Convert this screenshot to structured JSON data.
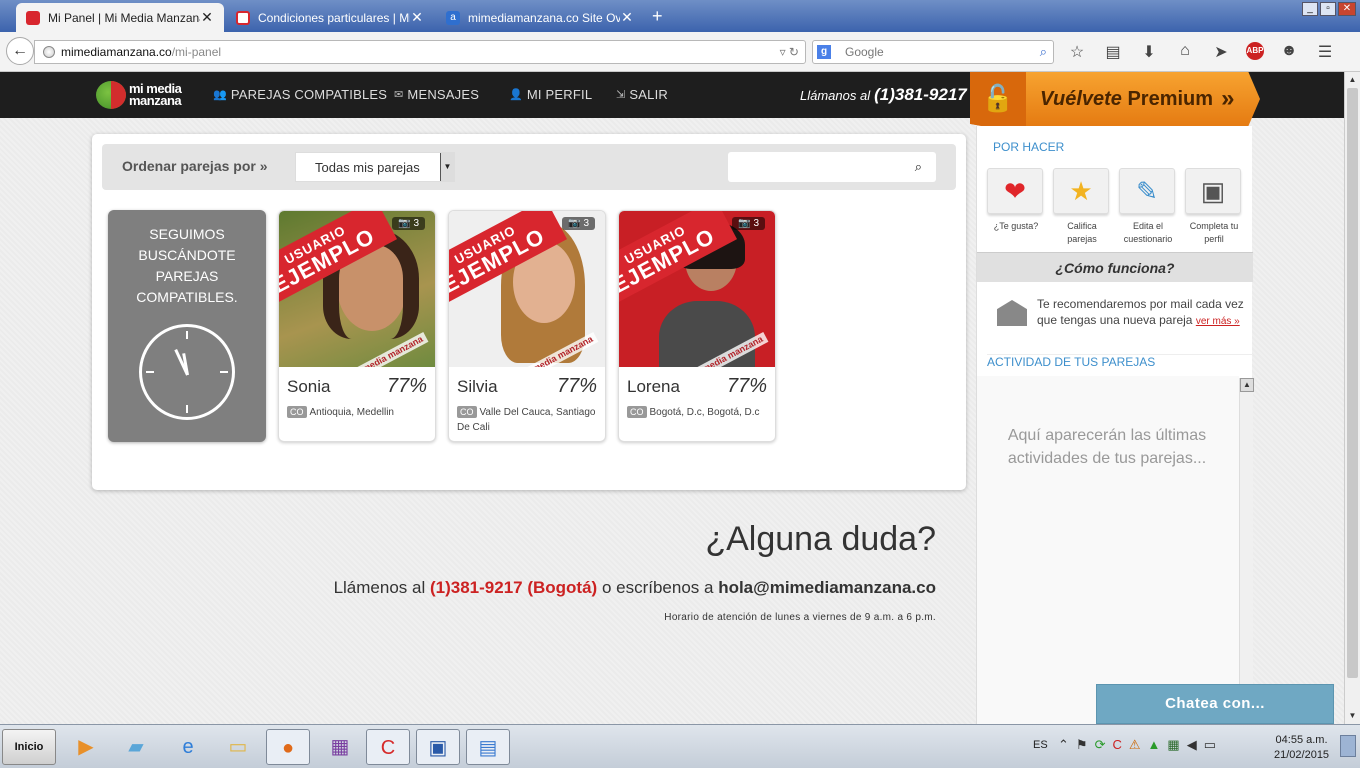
{
  "browser": {
    "tabs": [
      {
        "title": "Mi Panel | Mi Media Manzana ...",
        "active": true
      },
      {
        "title": "Condiciones particulares | Mi ...",
        "active": false
      },
      {
        "title": "mimediamanzana.co Site Ove...",
        "active": false
      }
    ],
    "url_host": "mimediamanzana.co",
    "url_path": "/mi-panel",
    "search_placeholder": "Google"
  },
  "site": {
    "logo_line1": "mi media",
    "logo_line2": "manzana",
    "nav": [
      {
        "label": "PAREJAS COMPATIBLES",
        "icon": "users-icon"
      },
      {
        "label": "MENSAJES",
        "icon": "envelope-icon"
      },
      {
        "label": "MI PERFIL",
        "icon": "user-icon"
      },
      {
        "label": "SALIR",
        "icon": "sign-out-icon"
      }
    ],
    "call_label": "Llámanos al",
    "call_phone": "(1)381-9217",
    "premium_prefix": "Vuélvete",
    "premium_label": "Premium"
  },
  "main": {
    "sort_label": "Ordenar parejas por »",
    "sort_value": "Todas mis parejas",
    "search_placeholder": "",
    "status_message": "SEGUIMOS\nBUSCÁNDOTE\nPAREJAS\nCOMPATIBLES.",
    "profiles": [
      {
        "name": "Sonia",
        "match": "77%",
        "country": "CO",
        "location": "Antioquia, Medellin",
        "photos": "3",
        "ribbon_top": "USUARIO",
        "ribbon_bottom": "EJEMPLO",
        "stamp": "mi media manzana",
        "bg": "#6f8b3f"
      },
      {
        "name": "Silvia",
        "match": "77%",
        "country": "CO",
        "location": "Valle Del Cauca, Santiago De Cali",
        "photos": "3",
        "ribbon_top": "USUARIO",
        "ribbon_bottom": "EJEMPLO",
        "stamp": "mi media manzana",
        "bg": "#ececec"
      },
      {
        "name": "Lorena",
        "match": "77%",
        "country": "CO",
        "location": "Bogotá, D.c, Bogotá, D.c",
        "photos": "3",
        "ribbon_top": "USUARIO",
        "ribbon_bottom": "EJEMPLO",
        "stamp": "mi media manzana",
        "bg": "#c81f25"
      }
    ]
  },
  "footer": {
    "question": "¿Alguna duda?",
    "call_prefix": "Llámenos al",
    "phone": "(1)381-9217 (Bogotá)",
    "write_text": "o escríbenos a",
    "email": "hola@mimediamanzana.co",
    "hours": "Horario de atención de lunes a viernes de 9 a.m. a 6 p.m."
  },
  "sidebar": {
    "todo_title": "POR HACER",
    "todo": [
      {
        "label": "¿Te gusta?",
        "icon": "heart-icon",
        "color": "#e0262a"
      },
      {
        "label": "Califica parejas",
        "icon": "star-icon",
        "color": "#f2b321"
      },
      {
        "label": "Edita el cuestionario",
        "icon": "edit-icon",
        "color": "#3d8fcc"
      },
      {
        "label": "Completa tu perfil",
        "icon": "profile-card-icon",
        "color": "#555555"
      }
    ],
    "howto_title": "¿Cómo funciona?",
    "howto_text": "Te recomendaremos por mail cada vez que tengas una nueva pareja",
    "howto_link": "ver más »",
    "activity_title": "ACTIVIDAD DE TUS PAREJAS",
    "activity_empty": "Aquí aparecerán las últimas actividades de tus parejas...",
    "chat_label": "Chatea con..."
  },
  "taskbar": {
    "start_label": "Inicio",
    "lang": "ES",
    "time": "04:55 a.m.",
    "date": "21/02/2015"
  }
}
